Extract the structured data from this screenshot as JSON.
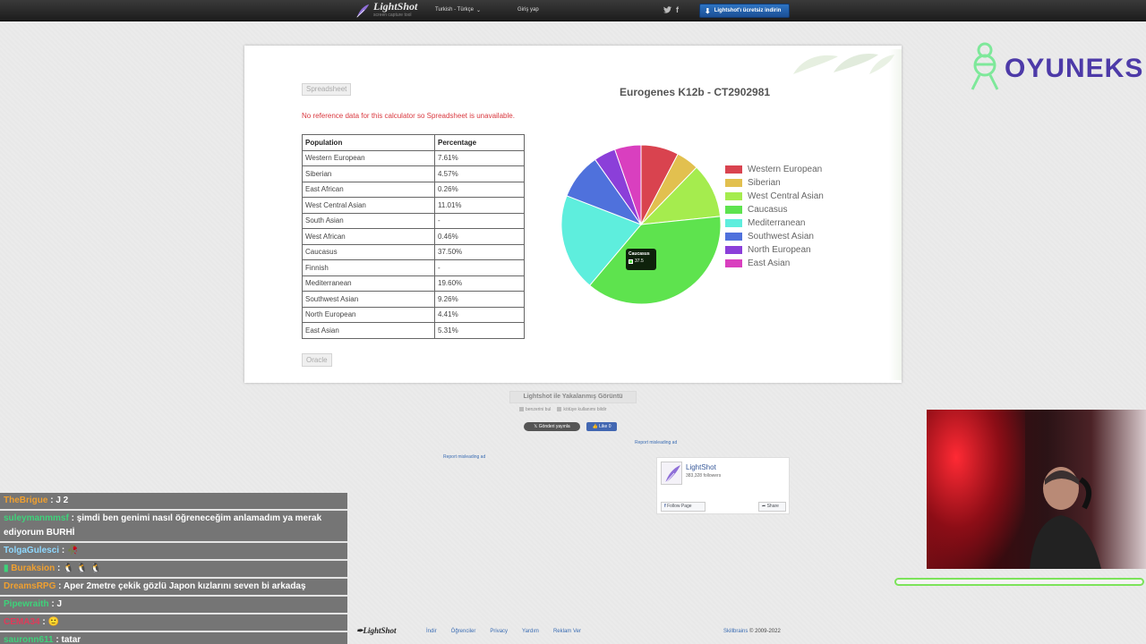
{
  "topbar": {
    "brand": "LightShot",
    "tagline": "screen capture tool",
    "language": "Turkish - Türkçe",
    "login": "Giriş yap",
    "download": "Lightshot'ı ücretsiz indirin"
  },
  "card": {
    "spreadsheet_button": "Spreadsheet",
    "unavailable_message": "No reference data for this calculator so Spreadsheet is unavailable.",
    "oracle_button": "Oracle",
    "table": {
      "headers": [
        "Population",
        "Percentage"
      ],
      "rows": [
        [
          "Western European",
          "7.61%"
        ],
        [
          "Siberian",
          "4.57%"
        ],
        [
          "East African",
          "0.26%"
        ],
        [
          "West Central Asian",
          "11.01%"
        ],
        [
          "South Asian",
          "-"
        ],
        [
          "West African",
          "0.46%"
        ],
        [
          "Caucasus",
          "37.50%"
        ],
        [
          "Finnish",
          "-"
        ],
        [
          "Mediterranean",
          "19.60%"
        ],
        [
          "Southwest Asian",
          "9.26%"
        ],
        [
          "North European",
          "4.41%"
        ],
        [
          "East Asian",
          "5.31%"
        ]
      ]
    },
    "tooltip": {
      "title": "Caucasus",
      "value": "37.5"
    }
  },
  "chart_data": {
    "type": "pie",
    "title": "Eurogenes K12b - CT2902981",
    "legend_position": "right",
    "slices": [
      {
        "label": "Western European",
        "value": 7.61,
        "color": "#d9434f"
      },
      {
        "label": "Siberian",
        "value": 4.57,
        "color": "#e2c04f"
      },
      {
        "label": "West Central Asian",
        "value": 11.01,
        "color": "#a5ec4e"
      },
      {
        "label": "Caucasus",
        "value": 37.5,
        "color": "#5ee34e"
      },
      {
        "label": "Mediterranean",
        "value": 19.6,
        "color": "#5eeedd"
      },
      {
        "label": "Southwest Asian",
        "value": 9.26,
        "color": "#4f71dc"
      },
      {
        "label": "North European",
        "value": 4.41,
        "color": "#8b3fd9"
      },
      {
        "label": "East Asian",
        "value": 5.31,
        "color": "#d93fbf"
      }
    ]
  },
  "below": {
    "caption": "Lightshot ile Yakalanmış Görüntü",
    "similar": "benzerini bul",
    "report_use": "kötüye kullanımı bildir",
    "tweet": "Gönderi yayınla",
    "like": "Like 0",
    "report_ad_1": "Report misleading ad",
    "report_ad_2": "Report misleading ad"
  },
  "fb_widget": {
    "name": "LightShot",
    "followers": "383,328 followers",
    "follow": "Follow Page",
    "share": "Share"
  },
  "footer": {
    "logo": "LightShot",
    "links": [
      "İndir",
      "Öğrenciler",
      "Privacy",
      "Yardım",
      "Reklam Ver"
    ],
    "company": "Skillbrains",
    "copyright": "© 2009-2022"
  },
  "overlay": {
    "brand": "OYUNEKS",
    "chat": [
      {
        "user": "TheBrigue",
        "color": "#f0a030",
        "text": ": J 2"
      },
      {
        "user": "suleymanmmsf",
        "color": "#3ed27a",
        "text": ": şimdi ben genimi nasıl öğreneceğim anlamadım ya merak ediyorum BURHİ"
      },
      {
        "user": "TolgaGulesci",
        "color": "#8fd8ff",
        "text": ":"
      },
      {
        "user": "Buraksion",
        "color": "#f0a030",
        "text": ":"
      },
      {
        "user": "DreamsRPG",
        "color": "#f0a030",
        "text": ": Aper 2metre çekik gözlü Japon kızlarını seven bi arkadaş"
      },
      {
        "user": "Pipewraith",
        "color": "#3ed27a",
        "text": ": J"
      },
      {
        "user": "CEMA34",
        "color": "#e03a5a",
        "text": ":"
      },
      {
        "user": "sauronn611",
        "color": "#3ed27a",
        "text": ": tatar"
      }
    ],
    "progress_fraction": 0.0
  }
}
